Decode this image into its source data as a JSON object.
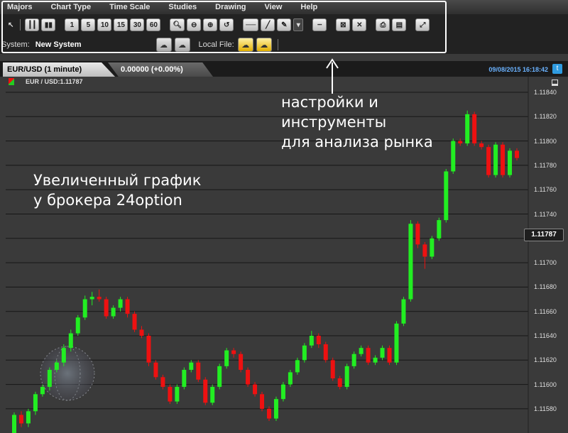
{
  "menu": [
    "Majors",
    "Chart Type",
    "Time Scale",
    "Studies",
    "Drawing",
    "View",
    "Help"
  ],
  "toolbar": {
    "timeframes": [
      "1",
      "5",
      "10",
      "15",
      "30",
      "60"
    ],
    "tool_icons": [
      "cursor-icon",
      "bar-chart-icon",
      "candle-chart-icon",
      "zoom-in-icon",
      "zoom-out-icon",
      "zoom-fit-icon",
      "zoom-reset-icon",
      "horizontal-line-icon",
      "trend-line-icon",
      "pencil-icon",
      "dropdown-icon",
      "dotted-line-icon",
      "delete-box-icon",
      "close-icon",
      "print-icon",
      "window-icon",
      "fullscreen-icon"
    ]
  },
  "system": {
    "label": "System:",
    "value": "New System",
    "local_file_label": "Local File:"
  },
  "chart_header": {
    "symbol_tab": "EUR/USD (1 minute)",
    "price_change": "0.00000 (+0.00%)",
    "timestamp": "09/08/2015 16:18:42"
  },
  "legend": {
    "symbol": "EUR / USD:1.11787"
  },
  "annotations": {
    "tools": [
      "настройки и",
      "инструменты",
      "для анализа рынка"
    ],
    "chart": [
      "Увеличенный график",
      "у брокера 24option"
    ]
  },
  "colors": {
    "up": "#22ee22",
    "down": "#ee1111",
    "grid": "#161616",
    "background": "#3a3a3a"
  },
  "chart_data": {
    "type": "candlestick",
    "title": "",
    "current_price": "1.11787",
    "yticks": [
      "1.11840",
      "1.11820",
      "1.11800",
      "1.11780",
      "1.11760",
      "1.11740",
      "1.11720",
      "1.11700",
      "1.11680",
      "1.11660",
      "1.11640",
      "1.11620",
      "1.11600",
      "1.11580"
    ],
    "ylim": [
      1.1157,
      1.1185
    ],
    "candles": [
      [
        1.1156,
        1.11575,
        1.1155,
        1.11577
      ],
      [
        1.11575,
        1.11568,
        1.11565,
        1.11578
      ],
      [
        1.11568,
        1.11578,
        1.11565,
        1.1158
      ],
      [
        1.11578,
        1.11592,
        1.11575,
        1.11594
      ],
      [
        1.11592,
        1.11598,
        1.1159,
        1.116
      ],
      [
        1.11598,
        1.11612,
        1.11595,
        1.11614
      ],
      [
        1.11612,
        1.11618,
        1.1161,
        1.1162
      ],
      [
        1.11618,
        1.1163,
        1.11615,
        1.11633
      ],
      [
        1.1163,
        1.11642,
        1.11627,
        1.11645
      ],
      [
        1.11642,
        1.11655,
        1.1164,
        1.11657
      ],
      [
        1.11655,
        1.1167,
        1.11653,
        1.11673
      ],
      [
        1.1167,
        1.11672,
        1.11665,
        1.11676
      ],
      [
        1.11672,
        1.1167,
        1.11668,
        1.11678
      ],
      [
        1.1167,
        1.11656,
        1.11654,
        1.11672
      ],
      [
        1.11656,
        1.11663,
        1.11654,
        1.11665
      ],
      [
        1.11663,
        1.1167,
        1.1166,
        1.11672
      ],
      [
        1.1167,
        1.11658,
        1.11655,
        1.11672
      ],
      [
        1.11658,
        1.11645,
        1.11643,
        1.1166
      ],
      [
        1.11645,
        1.1164,
        1.11638,
        1.11648
      ],
      [
        1.1164,
        1.11618,
        1.11615,
        1.11642
      ],
      [
        1.11618,
        1.11606,
        1.11604,
        1.1162
      ],
      [
        1.11606,
        1.11598,
        1.11596,
        1.11608
      ],
      [
        1.11598,
        1.11586,
        1.11584,
        1.116
      ],
      [
        1.11586,
        1.11598,
        1.11584,
        1.116
      ],
      [
        1.11598,
        1.11612,
        1.11596,
        1.11614
      ],
      [
        1.11612,
        1.11618,
        1.1161,
        1.1162
      ],
      [
        1.11618,
        1.11604,
        1.11602,
        1.1162
      ],
      [
        1.11604,
        1.11585,
        1.11583,
        1.11606
      ],
      [
        1.11585,
        1.11598,
        1.11583,
        1.116
      ],
      [
        1.11598,
        1.11615,
        1.11596,
        1.11617
      ],
      [
        1.11615,
        1.11628,
        1.11613,
        1.1163
      ],
      [
        1.11628,
        1.11625,
        1.11622,
        1.1163
      ],
      [
        1.11625,
        1.11612,
        1.1161,
        1.11627
      ],
      [
        1.11612,
        1.116,
        1.11598,
        1.11614
      ],
      [
        1.116,
        1.11592,
        1.1159,
        1.11602
      ],
      [
        1.11592,
        1.1158,
        1.11578,
        1.11594
      ],
      [
        1.1158,
        1.11572,
        1.1157,
        1.11582
      ],
      [
        1.11572,
        1.11588,
        1.1157,
        1.1159
      ],
      [
        1.11588,
        1.116,
        1.11586,
        1.11602
      ],
      [
        1.116,
        1.1161,
        1.11598,
        1.11612
      ],
      [
        1.1161,
        1.1162,
        1.11608,
        1.11622
      ],
      [
        1.1162,
        1.11632,
        1.11618,
        1.11634
      ],
      [
        1.11632,
        1.1164,
        1.1163,
        1.11644
      ],
      [
        1.1164,
        1.11633,
        1.1163,
        1.11642
      ],
      [
        1.11633,
        1.1162,
        1.11618,
        1.11635
      ],
      [
        1.1162,
        1.11605,
        1.11603,
        1.11622
      ],
      [
        1.11605,
        1.11598,
        1.11596,
        1.11607
      ],
      [
        1.11598,
        1.11615,
        1.11596,
        1.11617
      ],
      [
        1.11615,
        1.11625,
        1.11613,
        1.11627
      ],
      [
        1.11625,
        1.1163,
        1.11623,
        1.11632
      ],
      [
        1.1163,
        1.11618,
        1.11616,
        1.11632
      ],
      [
        1.11618,
        1.11622,
        1.11616,
        1.11624
      ],
      [
        1.11622,
        1.1163,
        1.1162,
        1.11632
      ],
      [
        1.1163,
        1.11618,
        1.11616,
        1.11632
      ],
      [
        1.11618,
        1.1165,
        1.11616,
        1.11652
      ],
      [
        1.1165,
        1.1167,
        1.11648,
        1.11672
      ],
      [
        1.1167,
        1.11732,
        1.11668,
        1.11735
      ],
      [
        1.11732,
        1.11715,
        1.11712,
        1.11734
      ],
      [
        1.11715,
        1.11705,
        1.11695,
        1.11717
      ],
      [
        1.11705,
        1.1172,
        1.11703,
        1.11722
      ],
      [
        1.1172,
        1.11735,
        1.11718,
        1.11737
      ],
      [
        1.11735,
        1.11775,
        1.11733,
        1.11777
      ],
      [
        1.11775,
        1.118,
        1.11773,
        1.11802
      ],
      [
        1.118,
        1.11798,
        1.11796,
        1.11802
      ],
      [
        1.11798,
        1.11822,
        1.11796,
        1.11825
      ],
      [
        1.11822,
        1.11798,
        1.11796,
        1.11824
      ],
      [
        1.11798,
        1.11795,
        1.11793,
        1.118
      ],
      [
        1.11795,
        1.11772,
        1.1177,
        1.11797
      ],
      [
        1.11772,
        1.11797,
        1.1177,
        1.11799
      ],
      [
        1.11797,
        1.11772,
        1.1177,
        1.11799
      ],
      [
        1.11772,
        1.11792,
        1.1177,
        1.11794
      ],
      [
        1.11792,
        1.11786,
        1.11784,
        1.11794
      ]
    ]
  }
}
